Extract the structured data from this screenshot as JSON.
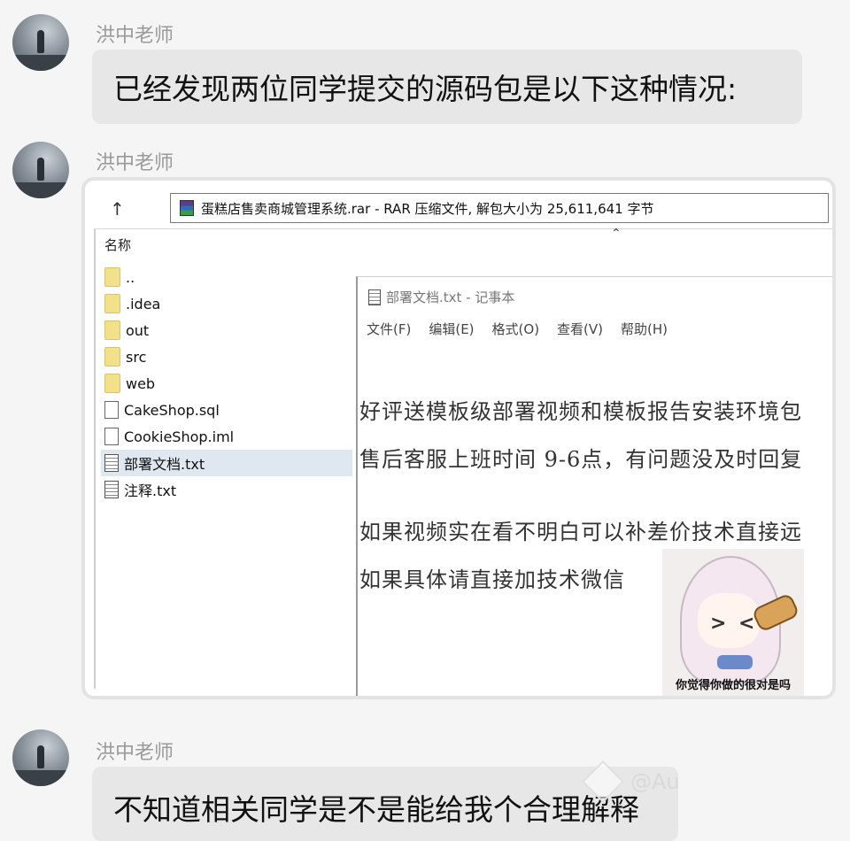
{
  "messages": [
    {
      "sender": "洪中老师",
      "text": "已经发现两位同学提交的源码包是以下这种情况:"
    },
    {
      "sender": "洪中老师"
    },
    {
      "sender": "洪中老师",
      "text": "不知道相关同学是不是能给我个合理解释"
    }
  ],
  "explorer": {
    "up_icon": "↑",
    "address": "蛋糕店售卖商城管理系统.rar - RAR 压缩文件, 解包大小为 25,611,641 字节",
    "column_header": "名称",
    "files": [
      {
        "name": "..",
        "icon": "folder-icon"
      },
      {
        "name": ".idea",
        "icon": "folder-icon"
      },
      {
        "name": "out",
        "icon": "folder-icon"
      },
      {
        "name": "src",
        "icon": "folder-icon"
      },
      {
        "name": "web",
        "icon": "folder-icon"
      },
      {
        "name": "CakeShop.sql",
        "icon": "file-icon"
      },
      {
        "name": "CookieShop.iml",
        "icon": "file-icon"
      },
      {
        "name": "部署文档.txt",
        "icon": "text-file-icon",
        "selected": true
      },
      {
        "name": "注释.txt",
        "icon": "text-file-icon"
      }
    ]
  },
  "notepad": {
    "title": "部署文档.txt - 记事本",
    "menu": [
      "文件(F)",
      "编辑(E)",
      "格式(O)",
      "查看(V)",
      "帮助(H)"
    ],
    "lines": [
      "好评送模板级部署视频和模板报告安装环境包",
      "售后客服上班时间  9-6点，有问题没及时回复",
      "如果视频实在看不明白可以补差价技术直接远",
      "如果具体请直接加技术微信"
    ]
  },
  "sticker": {
    "caption": "你觉得你做的很对是吗"
  },
  "watermark": {
    "text": "@Au"
  },
  "colors": {
    "bubble": "#e7e7e7",
    "background": "#f5f5f5",
    "selection": "#dfe7f0"
  }
}
